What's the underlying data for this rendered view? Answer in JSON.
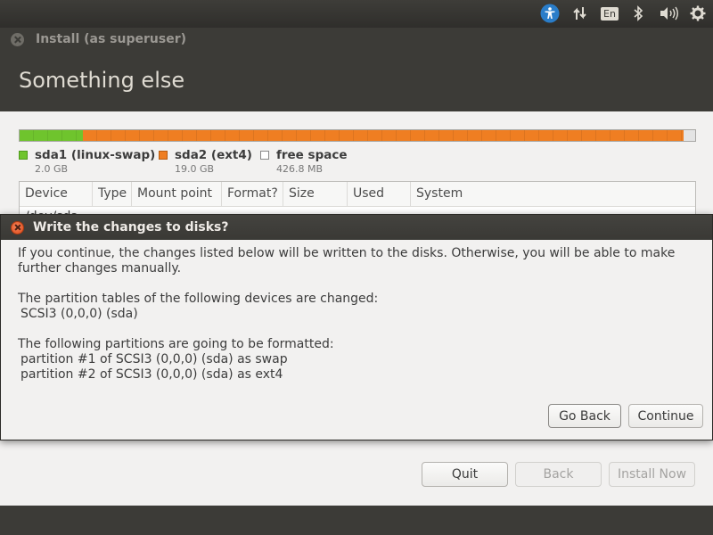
{
  "panel": {
    "indicators": [
      {
        "name": "accessibility-icon"
      },
      {
        "name": "network-icon"
      },
      {
        "name": "keyboard-layout",
        "label": "En"
      },
      {
        "name": "bluetooth-icon"
      },
      {
        "name": "volume-icon"
      },
      {
        "name": "system-gear-icon"
      }
    ],
    "accent_color": "#2a7dc9"
  },
  "installer": {
    "window_title": "Install (as superuser)",
    "page_heading": "Something else",
    "partition_bar": {
      "colors": {
        "sda1": "#6fc42d",
        "sda2": "#ef7e22",
        "free": "#e4e4e4"
      }
    },
    "legend": [
      {
        "name": "sda1 (linux-swap)",
        "size": "2.0 GB",
        "color": "#6fc42d"
      },
      {
        "name": "sda2 (ext4)",
        "size": "19.0 GB",
        "color": "#ef7e22"
      },
      {
        "name": "free space",
        "size": "426.8 MB",
        "color": "#ffffff"
      }
    ],
    "table": {
      "columns": [
        "Device",
        "Type",
        "Mount point",
        "Format?",
        "Size",
        "Used",
        "System"
      ],
      "first_row": "/dev/sda"
    },
    "buttons": {
      "quit": "Quit",
      "back": "Back",
      "install_now": "Install Now"
    }
  },
  "dialog": {
    "title": "Write the changes to disks?",
    "intro": "If you continue, the changes listed below will be written to the disks. Otherwise, you will be able to make further changes manually.",
    "tables_heading": "The partition tables of the following devices are changed:",
    "tables_device": "SCSI3 (0,0,0) (sda)",
    "format_heading": "The following partitions are going to be formatted:",
    "format_items": [
      "partition #1 of SCSI3 (0,0,0) (sda) as swap",
      "partition #2 of SCSI3 (0,0,0) (sda) as ext4"
    ],
    "go_back_label": "Go Back",
    "continue_label": "Continue"
  }
}
